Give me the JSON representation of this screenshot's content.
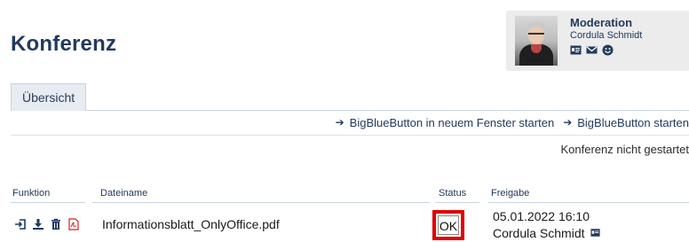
{
  "page": {
    "title": "Konferenz"
  },
  "moderator": {
    "role": "Moderation",
    "name": "Cordula Schmidt",
    "icons": [
      "vcard-icon",
      "mail-icon",
      "smiley-icon"
    ]
  },
  "tabs": [
    {
      "label": "Übersicht",
      "active": true
    }
  ],
  "actions": [
    {
      "label": "BigBlueButton in neuem Fenster starten"
    },
    {
      "label": "BigBlueButton starten"
    }
  ],
  "conference_status": "Konferenz nicht gestartet",
  "table": {
    "headers": {
      "function": "Funktion",
      "filename": "Dateiname",
      "status": "Status",
      "release": "Freigabe"
    },
    "rows": [
      {
        "icons": [
          "login-icon",
          "download-icon",
          "trash-icon",
          "pdf-icon"
        ],
        "filename": "Informationsblatt_OnlyOffice.pdf",
        "status": "OK",
        "release_date": "05.01.2022 16:10",
        "release_by": "Cordula Schmidt"
      }
    ]
  },
  "colors": {
    "brand_dark_blue": "#223a5e",
    "highlight_red": "#e00000",
    "tab_bg": "#e6ecf2"
  }
}
